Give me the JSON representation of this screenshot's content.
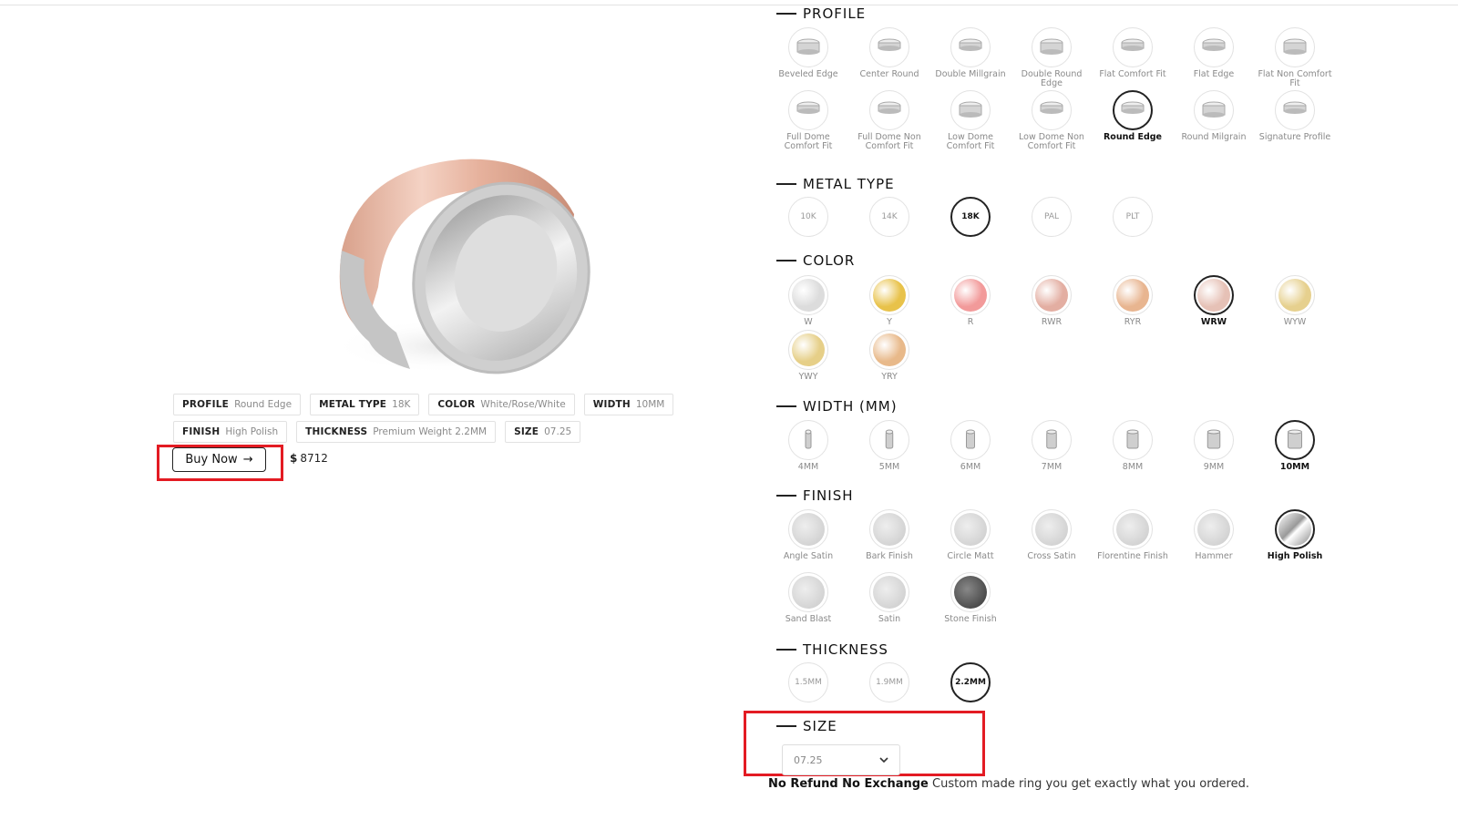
{
  "product": {
    "specs_row1": [
      {
        "key": "PROFILE",
        "value": "Round Edge"
      },
      {
        "key": "METAL TYPE",
        "value": "18K"
      },
      {
        "key": "COLOR",
        "value": "White/Rose/White"
      },
      {
        "key": "WIDTH",
        "value": "10MM"
      }
    ],
    "specs_row2": [
      {
        "key": "FINISH",
        "value": "High Polish"
      },
      {
        "key": "THICKNESS",
        "value": "Premium Weight 2.2MM"
      },
      {
        "key": "SIZE",
        "value": "07.25"
      }
    ],
    "buy_label": "Buy Now",
    "buy_arrow": "→",
    "price_currency": "$",
    "price_value": "8712"
  },
  "sections": {
    "profile": {
      "title": "PROFILE",
      "options": [
        "Beveled Edge",
        "Center Round",
        "Double Millgrain",
        "Double Round Edge",
        "Flat Comfort Fit",
        "Flat Edge",
        "Flat Non Comfort Fit",
        "Full Dome Comfort Fit",
        "Full Dome Non Comfort Fit",
        "Low Dome Comfort Fit",
        "Low Dome Non Comfort Fit",
        "Round Edge",
        "Round Milgrain",
        "Signature Profile"
      ],
      "selected": "Round Edge"
    },
    "metal": {
      "title": "METAL TYPE",
      "options": [
        "10K",
        "14K",
        "18K",
        "PAL",
        "PLT"
      ],
      "selected": "18K"
    },
    "color": {
      "title": "COLOR",
      "options": [
        "W",
        "Y",
        "R",
        "RWR",
        "RYR",
        "WRW",
        "WYW",
        "YWY",
        "YRY"
      ],
      "selected": "WRW",
      "swatches": {
        "W": "#dcdcdc",
        "Y": "#e8c24a",
        "R": "#f29a9a",
        "RWR": "#e3aea2",
        "RYR": "#e8b590",
        "WRW": "#e6c1b6",
        "WYW": "#e6d08e",
        "YWY": "#e6cf88",
        "YRY": "#e8b98a"
      }
    },
    "width": {
      "title": "WIDTH (MM)",
      "options": [
        "4MM",
        "5MM",
        "6MM",
        "7MM",
        "8MM",
        "9MM",
        "10MM"
      ],
      "selected": "10MM"
    },
    "finish": {
      "title": "FINISH",
      "options": [
        "Angle Satin",
        "Bark Finish",
        "Circle Matt",
        "Cross Satin",
        "Florentine Finish",
        "Hammer",
        "High Polish",
        "Sand Blast",
        "Satin",
        "Stone Finish"
      ],
      "selected": "High Polish"
    },
    "thickness": {
      "title": "THICKNESS",
      "options": [
        "1.5MM",
        "1.9MM",
        "2.2MM"
      ],
      "selected": "2.2MM"
    },
    "size": {
      "title": "SIZE",
      "value": "07.25"
    }
  },
  "note": {
    "bold": "No Refund No Exchange",
    "text": "Custom made ring you get exactly what you ordered."
  },
  "colors": {
    "highlight": "#e31b23",
    "rose": "#e2a58c",
    "silver": "#d9d9d9"
  }
}
